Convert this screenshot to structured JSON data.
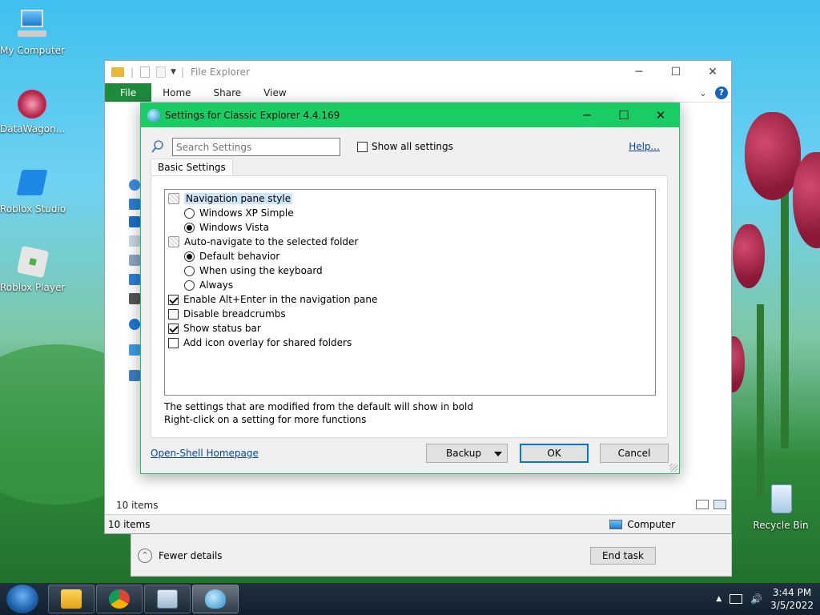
{
  "desktop": {
    "icons": [
      {
        "label": "My Computer"
      },
      {
        "label": "DataWagon..."
      },
      {
        "label": "Roblox Studio"
      },
      {
        "label": "Roblox Player"
      },
      {
        "label": "Recycle Bin"
      }
    ]
  },
  "explorer": {
    "title": "File Explorer",
    "tabs": [
      "File",
      "Home",
      "Share",
      "View"
    ],
    "help_glyph": "?",
    "status_items": "10 items",
    "status_items_bar": "10 items",
    "status_location": "Computer"
  },
  "task_manager": {
    "fewer_details": "Fewer details",
    "end_task": "End task"
  },
  "dialog": {
    "title": "Settings for Classic Explorer 4.4.169",
    "search_placeholder": "Search Settings",
    "show_all_label": "Show all settings",
    "show_all_checked": false,
    "help_link": "Help...",
    "tab": "Basic Settings",
    "settings": [
      {
        "type": "group",
        "label": "Navigation pane style"
      },
      {
        "type": "radio",
        "label": "Windows XP Simple",
        "checked": false
      },
      {
        "type": "radio",
        "label": "Windows Vista",
        "checked": true
      },
      {
        "type": "group",
        "label": "Auto-navigate to the selected folder"
      },
      {
        "type": "radio",
        "label": "Default behavior",
        "checked": true
      },
      {
        "type": "radio",
        "label": "When using the keyboard",
        "checked": false
      },
      {
        "type": "radio",
        "label": "Always",
        "checked": false
      },
      {
        "type": "check",
        "label": "Enable Alt+Enter in the navigation pane",
        "checked": true
      },
      {
        "type": "check",
        "label": "Disable breadcrumbs",
        "checked": false
      },
      {
        "type": "check",
        "label": "Show status bar",
        "checked": true
      },
      {
        "type": "check",
        "label": "Add icon overlay for shared folders",
        "checked": false
      }
    ],
    "note1": "The settings that are modified from the default will show in bold",
    "note2": "Right-click on a setting for more functions",
    "homepage_link": "Open-Shell Homepage",
    "backup_label": "Backup",
    "ok_label": "OK",
    "cancel_label": "Cancel"
  },
  "taskbar": {
    "time": "3:44 PM",
    "date": "3/5/2022"
  }
}
